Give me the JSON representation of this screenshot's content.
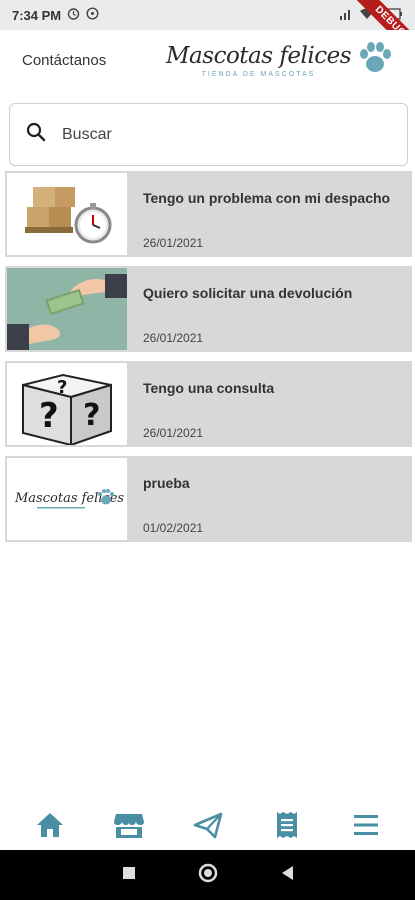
{
  "status_bar": {
    "time": "7:34 PM",
    "debug": "DEBUG"
  },
  "app_bar": {
    "title": "Contáctanos"
  },
  "logo": {
    "main": "Mascotas felices",
    "sub": "TIENDA DE MASCOTAS"
  },
  "search": {
    "placeholder": "Buscar"
  },
  "tickets": [
    {
      "title": "Tengo un problema con mi despacho",
      "date": "26/01/2021",
      "image": "boxes-stopwatch"
    },
    {
      "title": "Quiero solicitar una devolución",
      "date": "26/01/2021",
      "image": "money-exchange"
    },
    {
      "title": "Tengo una consulta",
      "date": "26/01/2021",
      "image": "question-cube"
    },
    {
      "title": "prueba",
      "date": "01/02/2021",
      "image": "logo"
    }
  ],
  "bottom_nav": [
    "home-icon",
    "store-icon",
    "send-icon",
    "receipt-icon",
    "menu-icon"
  ],
  "colors": {
    "accent": "#4a8ea3",
    "card_bg": "#d8d8d8",
    "status_bg": "#ebebeb",
    "debug": "#b71c1c"
  }
}
